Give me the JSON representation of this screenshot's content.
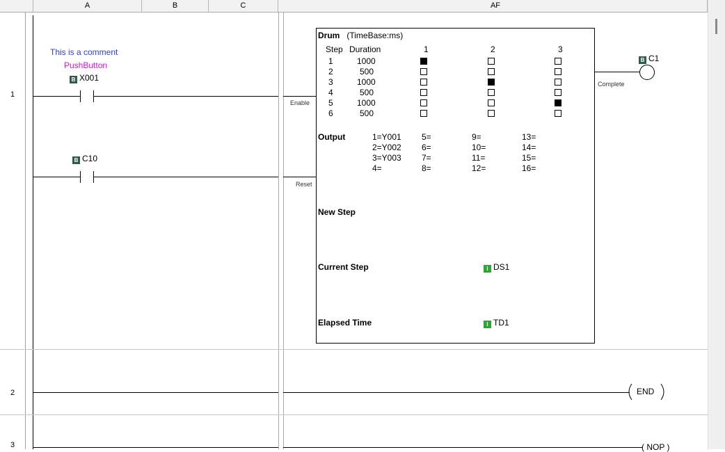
{
  "columns": {
    "a": "A",
    "b": "B",
    "c": "C",
    "af": "AF"
  },
  "rows": [
    "1",
    "2",
    "3"
  ],
  "rung1": {
    "comment": "This is a comment",
    "nickname": "PushButton",
    "contact1": {
      "type": "B",
      "address": "X001"
    },
    "contact2": {
      "type": "B",
      "address": "C10"
    },
    "enable_label": "Enable",
    "reset_label": "Reset",
    "complete_label": "Complete",
    "coil": {
      "type": "B",
      "address": "C1"
    }
  },
  "drum": {
    "title": "Drum",
    "timebase": "(TimeBase:ms)",
    "step_header": "Step",
    "duration_header": "Duration",
    "outputs_header": [
      "1",
      "2",
      "3"
    ],
    "steps": [
      {
        "step": "1",
        "duration": "1000",
        "states": [
          true,
          false,
          false
        ]
      },
      {
        "step": "2",
        "duration": "500",
        "states": [
          false,
          false,
          false
        ]
      },
      {
        "step": "3",
        "duration": "1000",
        "states": [
          false,
          true,
          false
        ]
      },
      {
        "step": "4",
        "duration": "500",
        "states": [
          false,
          false,
          false
        ]
      },
      {
        "step": "5",
        "duration": "1000",
        "states": [
          false,
          false,
          true
        ]
      },
      {
        "step": "6",
        "duration": "500",
        "states": [
          false,
          false,
          false
        ]
      }
    ],
    "output_label": "Output",
    "output_map": [
      [
        "1=Y001",
        "5=",
        "9=",
        "13="
      ],
      [
        "2=Y002",
        "6=",
        "10=",
        "14="
      ],
      [
        "3=Y003",
        "7=",
        "11=",
        "15="
      ],
      [
        "4=",
        "8=",
        "12=",
        "16="
      ]
    ],
    "new_step_label": "New Step",
    "current_step_label": "Current Step",
    "current_step": {
      "type": "I",
      "address": "DS1"
    },
    "elapsed_time_label": "Elapsed Time",
    "elapsed_time": {
      "type": "I",
      "address": "TD1"
    }
  },
  "rung2": {
    "instruction": "END"
  },
  "rung3": {
    "instruction": "( NOP )"
  }
}
